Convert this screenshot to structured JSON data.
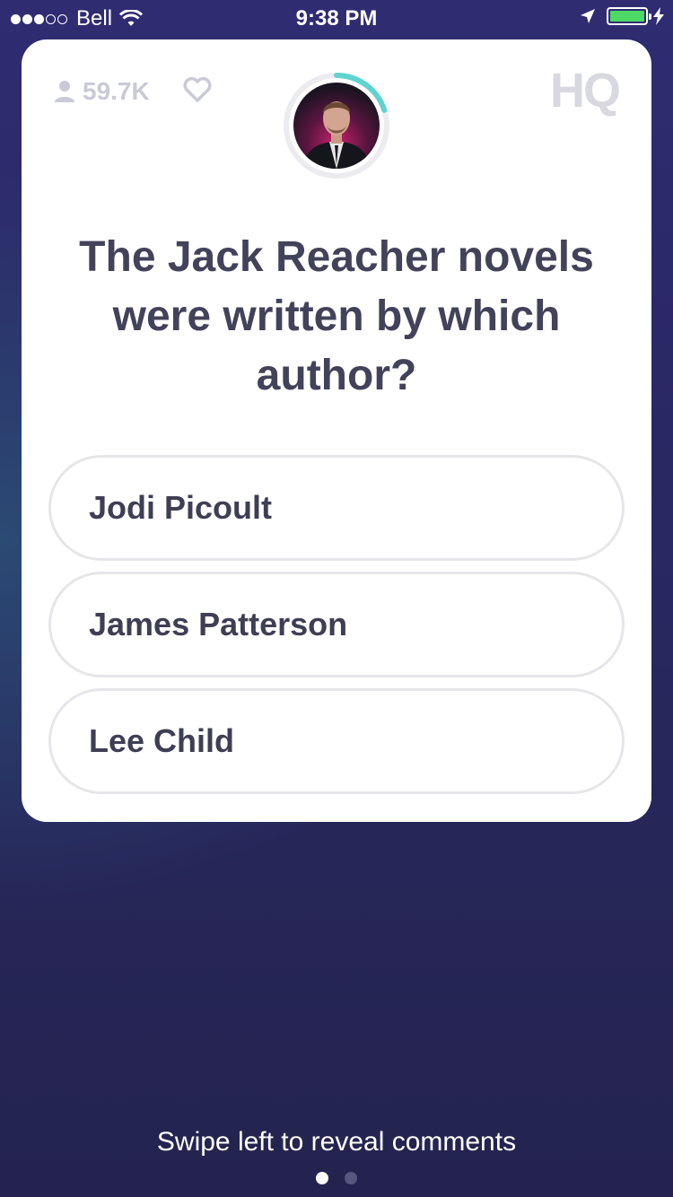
{
  "status_bar": {
    "carrier": "Bell",
    "time": "9:38 PM",
    "signal_bars_filled": 3,
    "signal_bars_total": 5,
    "battery_level": 1.0,
    "battery_color": "#4cd964"
  },
  "card": {
    "viewers": "59.7K",
    "logo_text": "HQ",
    "timer_progress": 0.2,
    "timer_color": "#5fd3cf",
    "question": "The Jack Reacher novels were written by which author?",
    "answers": [
      {
        "label": "Jodi Picoult"
      },
      {
        "label": "James Patterson"
      },
      {
        "label": "Lee Child"
      }
    ]
  },
  "footer": {
    "swipe_hint": "Swipe left to reveal comments",
    "page_count": 2,
    "active_page": 1
  },
  "icons": {
    "viewers": "person-icon",
    "like": "heart-icon",
    "location": "location-arrow-icon",
    "charging": "bolt-icon",
    "wifi": "wifi-icon"
  }
}
